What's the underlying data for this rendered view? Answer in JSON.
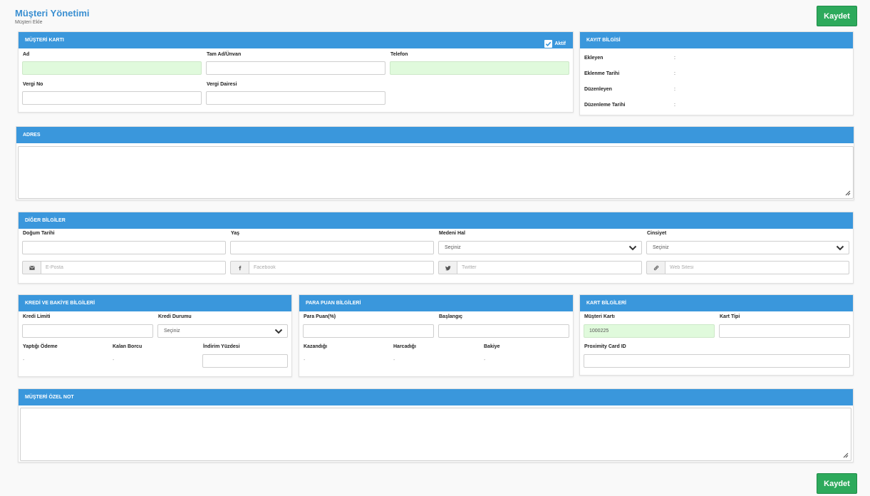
{
  "page": {
    "title": "Müşteri Yönetimi",
    "subtitle": "Müşteri Ekle",
    "save_label": "Kaydet"
  },
  "customer_card": {
    "header": "MÜŞTERİ KARTI",
    "active_label": "Aktif",
    "active_checked": true,
    "fields": {
      "ad": {
        "label": "Ad",
        "value": ""
      },
      "tam_ad": {
        "label": "Tam Ad/Ünvan",
        "value": ""
      },
      "telefon": {
        "label": "Telefon",
        "value": ""
      },
      "vergi_no": {
        "label": "Vergi No",
        "value": ""
      },
      "vergi_dairesi": {
        "label": "Vergi Dairesi",
        "value": ""
      }
    }
  },
  "record_info": {
    "header": "KAYIT BİLGİSİ",
    "rows": [
      {
        "label": "Ekleyen",
        "value": ":"
      },
      {
        "label": "Eklenme Tarihi",
        "value": ":"
      },
      {
        "label": "Düzenleyen",
        "value": ":"
      },
      {
        "label": "Düzenleme Tarihi",
        "value": ":"
      }
    ]
  },
  "address": {
    "header": "ADRES",
    "value": ""
  },
  "other_info": {
    "header": "DİĞER BİLGİLER",
    "dogum_tarihi": {
      "label": "Doğum Tarihi",
      "value": ""
    },
    "yas": {
      "label": "Yaş",
      "value": ""
    },
    "medeni_hal": {
      "label": "Medeni Hal",
      "selected": "Seçiniz"
    },
    "cinsiyet": {
      "label": "Cinsiyet",
      "selected": "Seçiniz"
    },
    "email": {
      "placeholder": "E-Posta",
      "icon": "envelope-icon"
    },
    "facebook": {
      "placeholder": "Facebook",
      "icon": "facebook-icon"
    },
    "twitter": {
      "placeholder": "Twitter",
      "icon": "twitter-icon"
    },
    "website": {
      "placeholder": "Web Sitesi",
      "icon": "link-icon"
    }
  },
  "credit": {
    "header": "KREDİ VE BAKİYE BİLGİLERİ",
    "kredi_limiti": {
      "label": "Kredi Limiti",
      "value": ""
    },
    "kredi_durumu": {
      "label": "Kredi Durumu",
      "selected": "Seçiniz"
    },
    "yaptigi_odeme": {
      "label": "Yaptığı Ödeme",
      "value": "-"
    },
    "kalan_borcu": {
      "label": "Kalan Borcu",
      "value": "-"
    },
    "indirim": {
      "label": "İndirim Yüzdesi",
      "value": ""
    }
  },
  "points": {
    "header": "PARA PUAN BİLGİLERİ",
    "para_puan": {
      "label": "Para Puan(%)",
      "value": ""
    },
    "baslangic": {
      "label": "Başlangıç",
      "value": ""
    },
    "kazandigi": {
      "label": "Kazandığı",
      "value": "-"
    },
    "harcadigi": {
      "label": "Harcadığı",
      "value": "-"
    },
    "bakiye": {
      "label": "Bakiye",
      "value": "-"
    }
  },
  "card_info": {
    "header": "KART BİLGİLERİ",
    "musteri_karti": {
      "label": "Müşteri Kartı",
      "value": "1000225"
    },
    "kart_tipi": {
      "label": "Kart Tipi",
      "value": ""
    },
    "proximity": {
      "label": "Proximity Card ID",
      "value": ""
    }
  },
  "note": {
    "header": "MÜŞTERİ ÖZEL NOT",
    "value": ""
  },
  "colors": {
    "accent": "#3a97dc",
    "save": "#2daa5c",
    "highlight_input": "#e0fadc",
    "title": "#3a8fd1"
  }
}
